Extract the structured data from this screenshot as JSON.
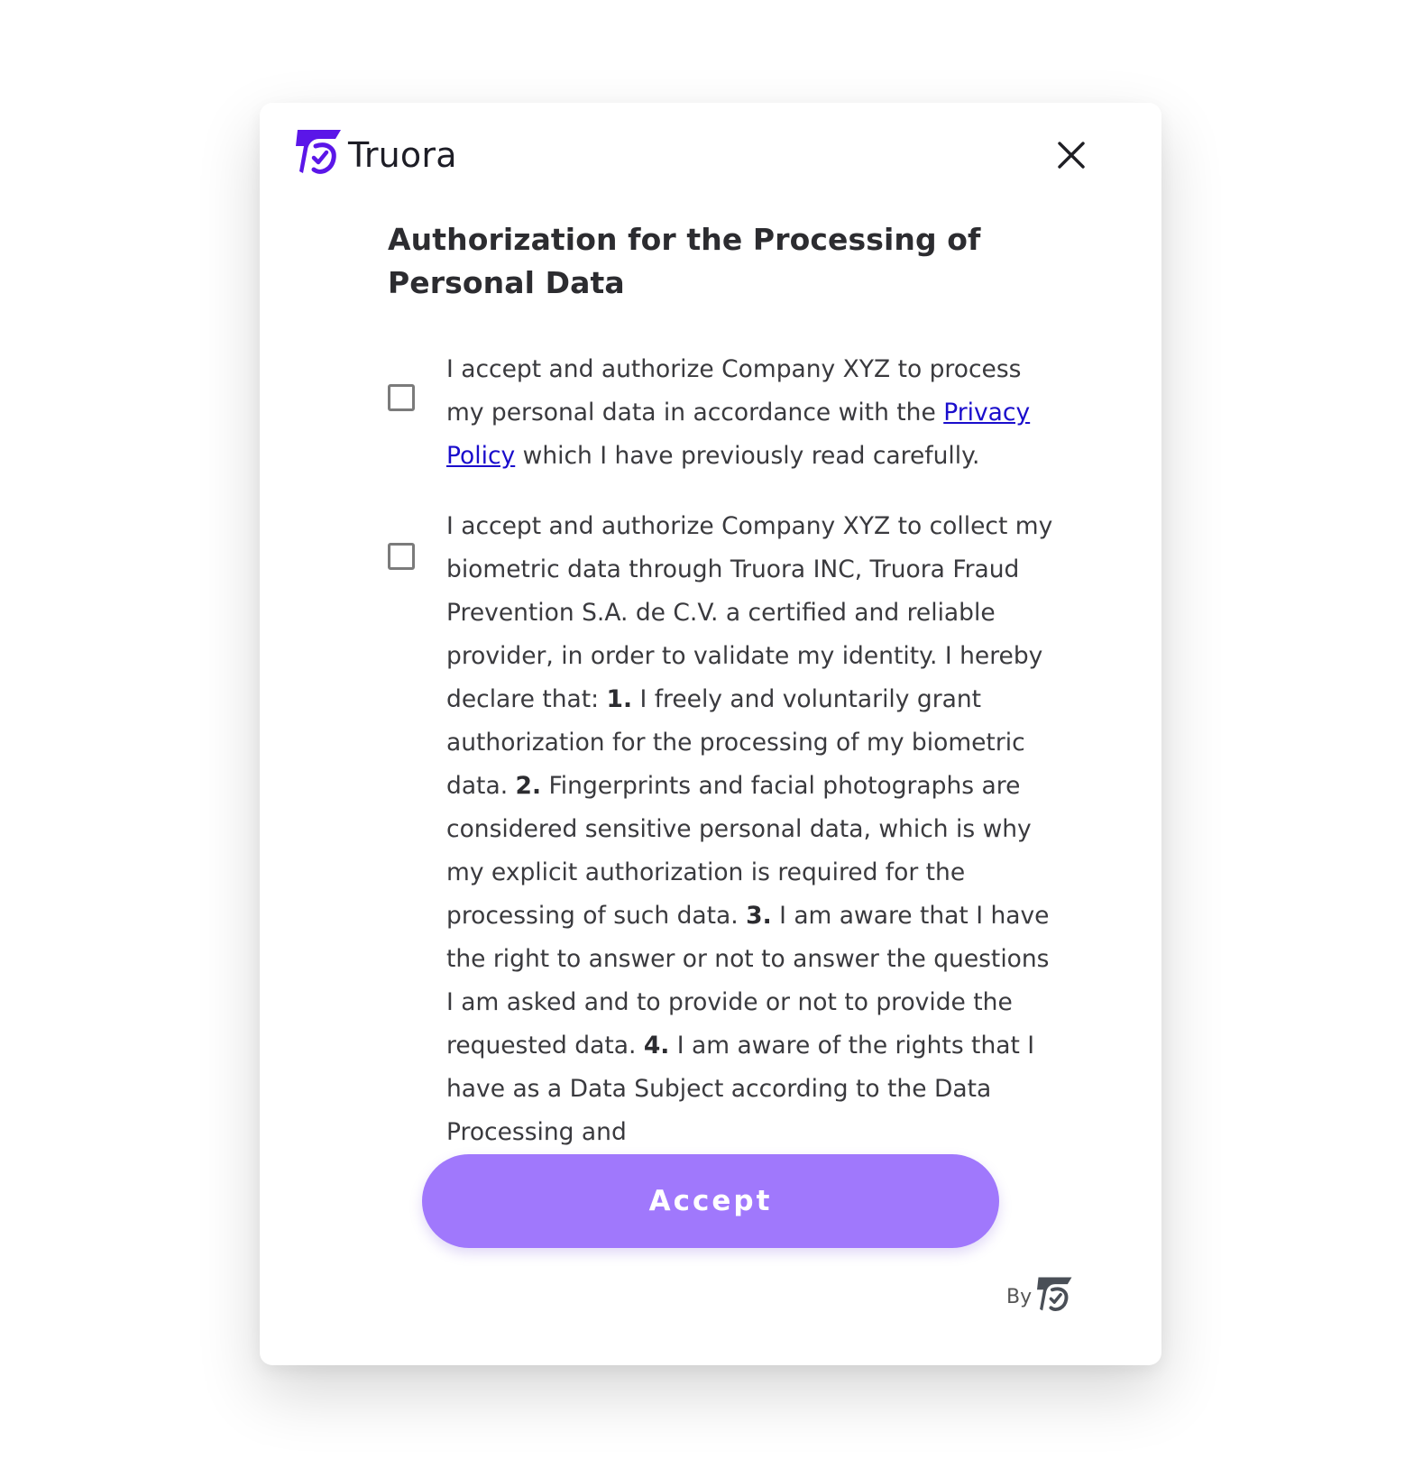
{
  "header": {
    "brand_name": "Truora",
    "logo_icon": "truora-logo-icon",
    "close_icon": "close-icon",
    "brand_color": "#5b16e8"
  },
  "title": "Authorization for the Processing of Personal Data",
  "consents": [
    {
      "checked": false,
      "text_before_link": "I accept and authorize Company XYZ to process my personal data in accordance with the ",
      "link_text": "Privacy Policy",
      "text_after_link": " which I have previously read carefully."
    },
    {
      "checked": false,
      "seg1": "I accept and authorize Company XYZ to collect my biometric data through Truora INC, Truora Fraud Prevention S.A. de C.V. a certified and reliable provider, in order to validate my identity. I hereby declare that: ",
      "num1": "1.",
      "seg2": " I freely and voluntarily grant authorization for the processing of my biometric data. ",
      "num2": "2.",
      "seg3": " Fingerprints and facial photographs are considered sensitive personal data, which is why my explicit authorization is required for the processing of such data. ",
      "num3": "3.",
      "seg4": " I am aware that I have the right to answer or not to answer the questions I am asked and to provide or not to provide the requested data. ",
      "num4": "4.",
      "seg5": " I am aware of the rights that I have as a Data Subject according to the Data Processing and"
    }
  ],
  "accept_button": {
    "label": "Accept",
    "color": "#a078fc"
  },
  "footer": {
    "by_label": "By",
    "logo_icon": "truora-mark-icon"
  }
}
